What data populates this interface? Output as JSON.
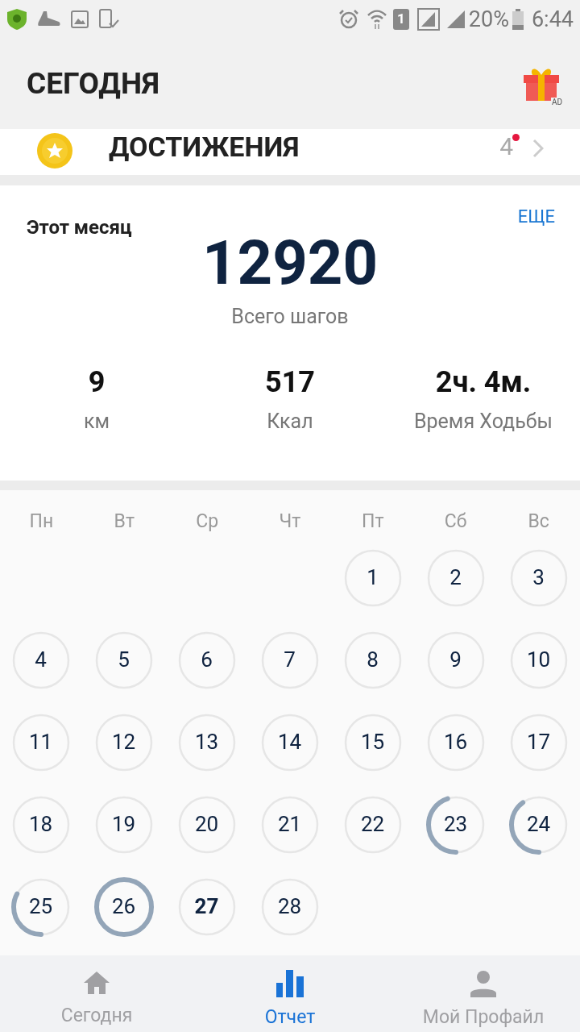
{
  "status_bar": {
    "battery": "20%",
    "time": "6:44",
    "sim": "1"
  },
  "header": {
    "title": "СЕГОДНЯ",
    "ad_badge": "AD"
  },
  "achievements": {
    "title": "ДОСТИЖЕНИЯ",
    "count": "4",
    "unread": true
  },
  "month": {
    "title": "Этот месяц",
    "more": "ЕЩЕ",
    "steps": "12920",
    "steps_label": "Всего шагов",
    "stats": [
      {
        "value": "9",
        "label": "км"
      },
      {
        "value": "517",
        "label": "Ккал"
      },
      {
        "value": "2ч. 4м.",
        "label": "Время Ходьбы"
      }
    ]
  },
  "calendar": {
    "weekdays": [
      "Пн",
      "Вт",
      "Ср",
      "Чт",
      "Пт",
      "Сб",
      "Вс"
    ],
    "days": [
      {
        "label": "1",
        "today": false
      },
      {
        "label": "2",
        "today": false
      },
      {
        "label": "3",
        "today": false
      },
      {
        "label": "4",
        "today": false
      },
      {
        "label": "5",
        "today": false
      },
      {
        "label": "6",
        "today": false
      },
      {
        "label": "7",
        "today": false
      },
      {
        "label": "8",
        "today": false
      },
      {
        "label": "9",
        "today": false
      },
      {
        "label": "10",
        "today": false
      },
      {
        "label": "11",
        "today": false
      },
      {
        "label": "12",
        "today": false
      },
      {
        "label": "13",
        "today": false
      },
      {
        "label": "14",
        "today": false
      },
      {
        "label": "15",
        "today": false
      },
      {
        "label": "16",
        "today": false
      },
      {
        "label": "17",
        "today": false
      },
      {
        "label": "18",
        "today": false
      },
      {
        "label": "19",
        "today": false
      },
      {
        "label": "20",
        "today": false
      },
      {
        "label": "21",
        "today": false
      },
      {
        "label": "22",
        "today": false
      },
      {
        "label": "23",
        "today": false
      },
      {
        "label": "24",
        "today": false
      },
      {
        "label": "25",
        "today": false
      },
      {
        "label": "26",
        "today": false
      },
      {
        "label": "27",
        "today": true
      },
      {
        "label": "28",
        "today": false
      }
    ]
  },
  "bottom_nav": [
    {
      "label": "Сегодня",
      "kind": "home",
      "selected": false
    },
    {
      "label": "Отчет",
      "kind": "report",
      "selected": true
    },
    {
      "label": "Мой Профайл",
      "kind": "profile",
      "selected": false
    }
  ]
}
